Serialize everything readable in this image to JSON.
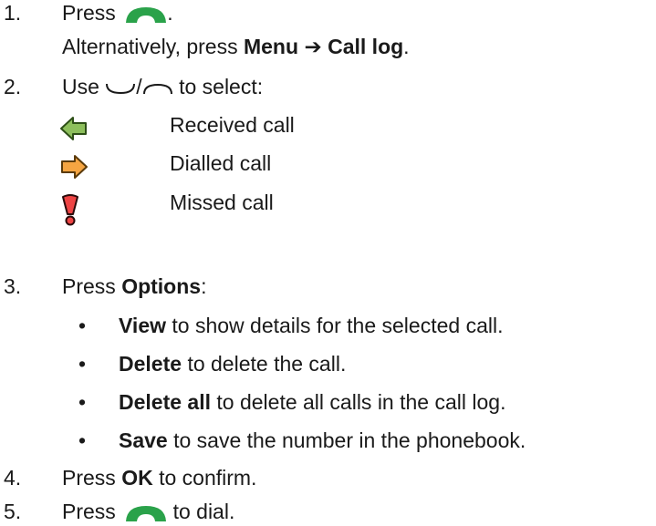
{
  "steps": {
    "s1": {
      "num": "1.",
      "press": "Press",
      "end": ".",
      "alt_prefix": "Alternatively, press",
      "alt_menu": "Menu",
      "alt_arrow": "➔",
      "alt_target": "Call log",
      "alt_end": "."
    },
    "s2": {
      "num": "2.",
      "use": "Use",
      "slash": "/",
      "rest": "to select:",
      "types": [
        {
          "label": "Received call",
          "icon": "received-arrow-icon",
          "color": "#8dbf5c"
        },
        {
          "label": "Dialled call",
          "icon": "dialled-arrow-icon",
          "color": "#f5a542"
        },
        {
          "label": "Missed call",
          "icon": "missed-exclamation-icon",
          "color": "#ee4444"
        }
      ]
    },
    "s3": {
      "num": "3.",
      "press": "Press",
      "options": "Options",
      "colon": ":",
      "bullets": [
        {
          "bold": "View",
          "text": "to show details for the selected call."
        },
        {
          "bold": "Delete",
          "text": "to delete the call."
        },
        {
          "bold": "Delete all",
          "text": "to delete all calls in the call log."
        },
        {
          "bold": "Save",
          "text": "to save the number in the phonebook."
        }
      ]
    },
    "s4": {
      "num": "4.",
      "press": "Press",
      "ok": "OK",
      "rest": "to confirm."
    },
    "s5": {
      "num": "5.",
      "press": "Press",
      "rest": "to dial."
    }
  },
  "colors": {
    "call_key": "#2aa24a",
    "text": "#1a1a1a"
  }
}
